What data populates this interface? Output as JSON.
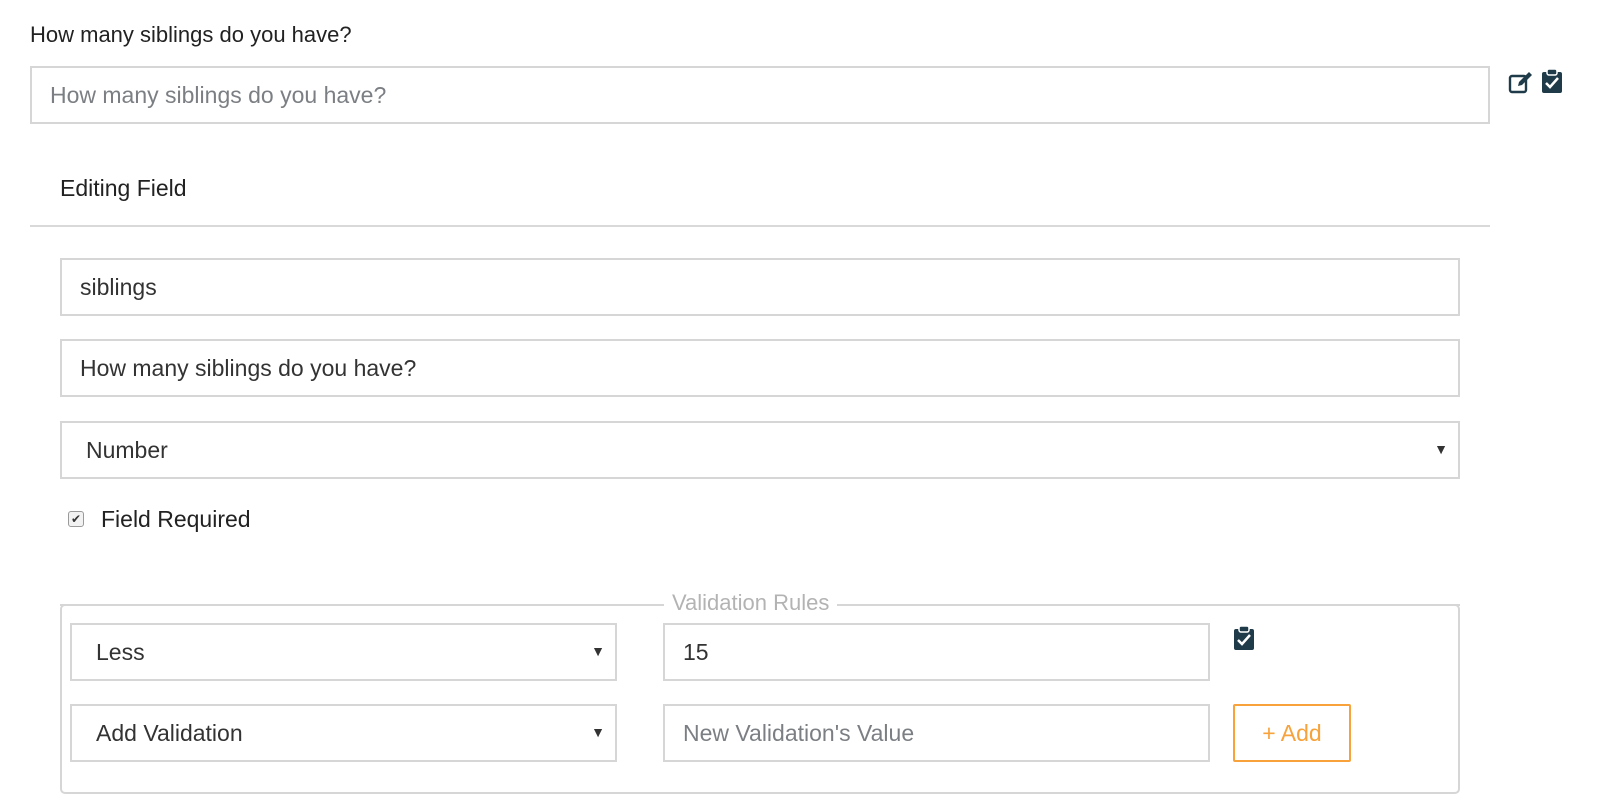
{
  "question": {
    "title": "How many siblings do you have?",
    "preview_placeholder": "How many siblings do you have?",
    "edit_icon": "edit-icon",
    "clipboard_icon": "clipboard-check-icon"
  },
  "editor": {
    "heading": "Editing Field",
    "field_name": "siblings",
    "field_label": "How many siblings do you have?",
    "field_type": "Number",
    "required_checked": true,
    "required_label": "Field Required"
  },
  "validation": {
    "legend": "Validation Rules",
    "rules": [
      {
        "type": "Less",
        "value": "15"
      }
    ],
    "new_rule": {
      "select_label": "Add Validation",
      "value_placeholder": "New Validation's Value",
      "add_label": "+ Add"
    }
  },
  "colors": {
    "accent_orange": "#f7a23a",
    "icon_dark": "#1f3a48",
    "border": "#d6d6d6"
  }
}
